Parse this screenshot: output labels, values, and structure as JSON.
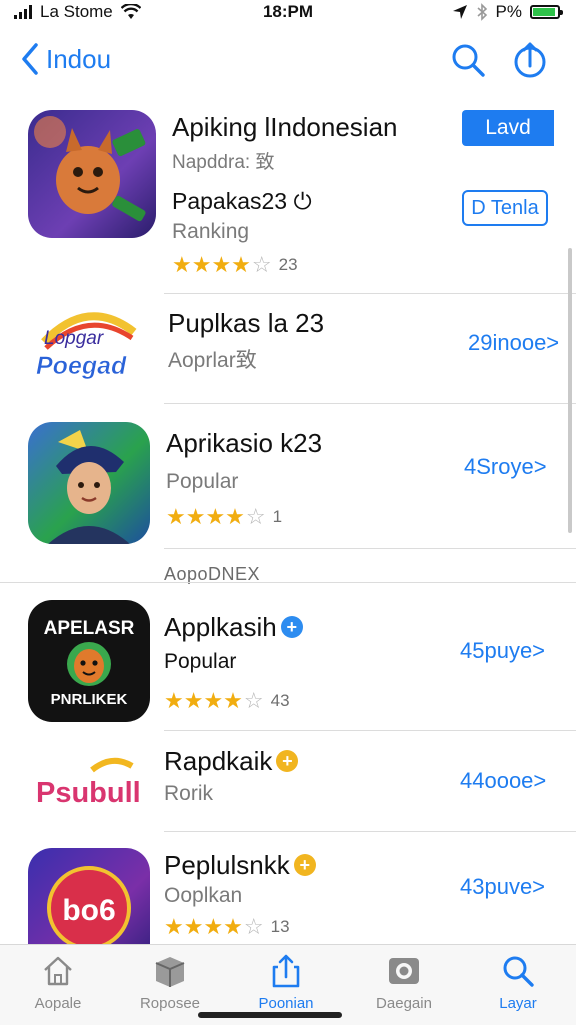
{
  "status_bar": {
    "carrier": "La Stome",
    "time": "18:PM",
    "battery_text": "P%"
  },
  "nav": {
    "back_label": "Indou"
  },
  "apps": [
    {
      "title": "Apiking lIndonesian",
      "subtitle": "Napddra: 致",
      "name2": "Papakas23 ⏻",
      "subtitle2": "Ranking",
      "rating_count": "23",
      "primary_button": "Lavd",
      "secondary_button": "D Tenla"
    },
    {
      "title": "Puplkas la 23",
      "subtitle": "Aoprlar致",
      "action": "29inooe>",
      "icon_text_1": "Lopgar",
      "icon_text_2": "Poegad"
    },
    {
      "title": "Aprikasio k23",
      "subtitle": "Popular",
      "rating_count": "1",
      "action": "4Sroye>"
    },
    {
      "title": "Applkasih",
      "subtitle": "Popular",
      "rating_count": "43",
      "action": "45puye>",
      "badge": "+",
      "icon_text_1": "APELASR",
      "icon_text_2": "PNRLIKEK"
    },
    {
      "title": "Rapdkaik",
      "subtitle": "Rorik",
      "action": "44oooe>",
      "badge": "+",
      "icon_text_1": "Psubull"
    },
    {
      "title": "Peplulsnkk",
      "subtitle": "Ooplkan",
      "rating_count": "13",
      "action": "43puve>",
      "badge": "+",
      "icon_text_1": "bo6"
    }
  ],
  "section_label": "AopoDNEX",
  "tabs": [
    {
      "label": "Aopale",
      "icon": "home-icon"
    },
    {
      "label": "Roposee",
      "icon": "box-icon"
    },
    {
      "label": "Poonian",
      "icon": "share-icon",
      "active": true
    },
    {
      "label": "Daegain",
      "icon": "camera-icon"
    },
    {
      "label": "Layar",
      "icon": "search-icon"
    }
  ],
  "colors": {
    "accent": "#1e7cf0",
    "star": "#f1ad10",
    "battery": "#2fc24a"
  }
}
